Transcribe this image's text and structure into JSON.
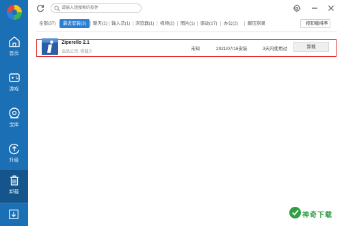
{
  "sidebar": {
    "items": [
      {
        "label": "首页",
        "icon": "home-icon"
      },
      {
        "label": "游戏",
        "icon": "gamepad-icon"
      },
      {
        "label": "宝库",
        "icon": "vault-icon"
      },
      {
        "label": "升级",
        "icon": "upgrade-icon"
      },
      {
        "label": "卸载",
        "icon": "trash-icon",
        "active": true
      }
    ],
    "bottom_icon": "download-icon"
  },
  "search": {
    "placeholder": "请输入想搜索的软件"
  },
  "tabs": [
    {
      "label": "全部(37)"
    },
    {
      "label": "最近安装(3)",
      "active": true
    },
    {
      "label": "聊天(1)"
    },
    {
      "label": "输入法(1)"
    },
    {
      "label": "浏览器(1)"
    },
    {
      "label": "视频(2)"
    },
    {
      "label": "图片(1)"
    },
    {
      "label": "驱动(17)"
    },
    {
      "label": "办公(2)"
    },
    {
      "label": "解压刻录"
    }
  ],
  "sort": {
    "label": "按卸载排序"
  },
  "apps": [
    {
      "name": "Ziperello 2.1",
      "publisher": "出品公司: 搭载少",
      "size": "未知",
      "install_date": "2021/07/16安装",
      "last_used": "3天内使用过",
      "action": "卸载"
    }
  ],
  "watermark": {
    "text": "神奇下载"
  },
  "colors": {
    "sidebar": "#1b6fb5",
    "accent": "#2a7fd4",
    "highlight": "#e03030",
    "watermark": "#2f9e44"
  }
}
